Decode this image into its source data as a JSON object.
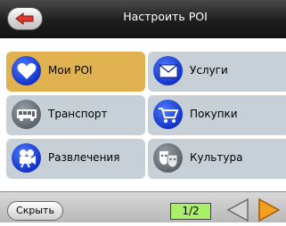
{
  "header": {
    "title": "Настроить POI",
    "back_icon": "back-arrow-icon"
  },
  "grid": {
    "items": [
      {
        "label": "Мои POI",
        "icon": "heart-icon",
        "state": "selected"
      },
      {
        "label": "Услуги",
        "icon": "envelope-icon",
        "state": "normal"
      },
      {
        "label": "Транспорт",
        "icon": "bus-icon",
        "state": "normal"
      },
      {
        "label": "Покупки",
        "icon": "shopping-cart-icon",
        "state": "normal"
      },
      {
        "label": "Развлечения",
        "icon": "film-camera-icon",
        "state": "normal"
      },
      {
        "label": "Культура",
        "icon": "theater-masks-icon",
        "state": "normal"
      }
    ]
  },
  "footer": {
    "hide_label": "Скрыть",
    "page_indicator": "1/2",
    "prev_icon": "prev-page-icon",
    "next_icon": "next-page-icon"
  },
  "colors": {
    "selected_bg": "#dfb14f",
    "cell_bg": "#c6d0d6",
    "page_indicator_bg": "#a9ef67",
    "next_arrow": "#f2a01e",
    "header_bg": "#1e1e1e"
  }
}
